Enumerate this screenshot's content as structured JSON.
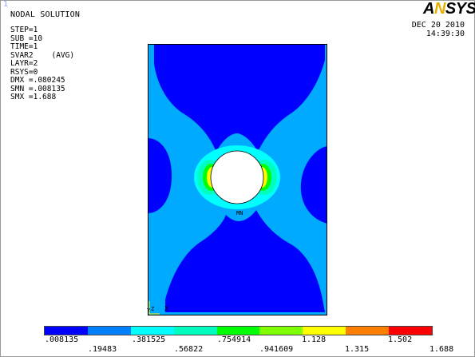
{
  "window_number": "1",
  "header": {
    "title": "NODAL SOLUTION",
    "logo_a": "A",
    "logo_n": "N",
    "logo_rest": "SYS",
    "date": "DEC 20 2010",
    "time": "14:39:30"
  },
  "info_lines": [
    "STEP=1",
    "SUB =10",
    "TIME=1",
    "SVAR2    (AVG)",
    "LAYR=2",
    "RSYS=0",
    "DMX =.080245",
    "SMN =.008135",
    "SMX =1.688"
  ],
  "node_label": "MN",
  "axis": {
    "y": "Y",
    "z": "Z",
    "x": "X"
  },
  "legend": {
    "colors": [
      "#0000ff",
      "#0080ff",
      "#00ffff",
      "#00ffbf",
      "#00ff00",
      "#80ff00",
      "#ffff00",
      "#ff8000",
      "#ff0000"
    ],
    "top_labels": [
      ".008135",
      ".381525",
      ".754914",
      "1.128",
      "1.502"
    ],
    "bottom_labels": [
      ".19483",
      ".56822",
      ".941609",
      "1.315",
      "1.688"
    ]
  },
  "contour_colors": {
    "dark_blue": "#0000ff",
    "light_blue": "#00aaff",
    "cyan": "#00ffff",
    "teal": "#00ffbf",
    "green": "#00ff00",
    "yellow": "#ffff00",
    "orange": "#ff8000",
    "red": "#ff0000"
  }
}
